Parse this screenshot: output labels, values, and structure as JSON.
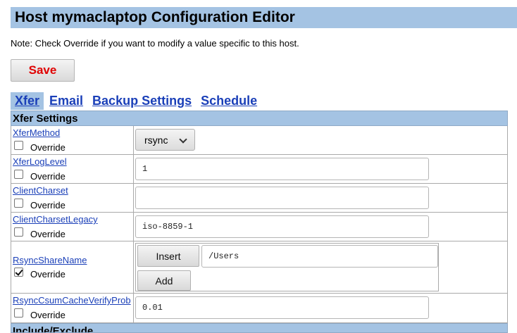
{
  "header": {
    "title": "Host mymaclaptop Configuration Editor"
  },
  "note": "Note: Check Override if you want to modify a value specific to this host.",
  "toolbar": {
    "save_label": "Save"
  },
  "tabs": [
    {
      "label": "Xfer",
      "active": true
    },
    {
      "label": "Email",
      "active": false
    },
    {
      "label": "Backup Settings",
      "active": false
    },
    {
      "label": "Schedule",
      "active": false
    }
  ],
  "sections": {
    "xfer_title": "Xfer Settings",
    "next_title": "Include/Exclude"
  },
  "override_label": "Override",
  "params": {
    "xfer_method": {
      "name": "XferMethod",
      "value": "rsync",
      "override": false
    },
    "xfer_log_level": {
      "name": "XferLogLevel",
      "value": "1",
      "override": false
    },
    "client_charset": {
      "name": "ClientCharset",
      "value": "",
      "override": false
    },
    "client_charset_legacy": {
      "name": "ClientCharsetLegacy",
      "value": "iso-8859-1",
      "override": false
    },
    "rsync_share_name": {
      "name": "RsyncShareName",
      "value": "/Users",
      "override": true,
      "insert_label": "Insert",
      "add_label": "Add"
    },
    "rsync_csum": {
      "name": "RsyncCsumCacheVerifyProb",
      "value": "0.01",
      "override": false
    }
  },
  "colors": {
    "header_bg": "#a4c3e3",
    "link": "#1a3fb8",
    "save_text": "#e00000"
  },
  "icons": {
    "select_arrow": "chevron-down-icon",
    "checkbox_checked": "checkmark-icon"
  }
}
